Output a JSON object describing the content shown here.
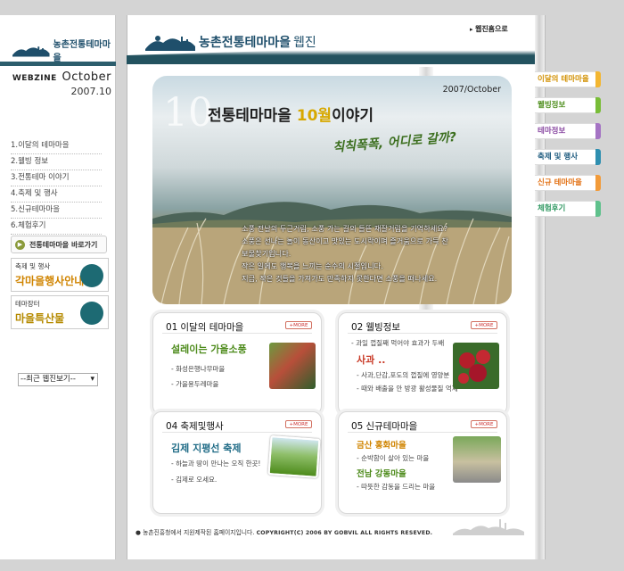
{
  "sidebar": {
    "logo_text": "농촌전통테마마을",
    "webzine_label": "WEBZINE",
    "issue_month": "October",
    "issue_date": "2007.10",
    "menu": [
      {
        "label": "1.이달의 테마마을"
      },
      {
        "label": "2.웰빙 정보"
      },
      {
        "label": "3.전통테마 이야기"
      },
      {
        "label": "4.축제 및 행사"
      },
      {
        "label": "5.신규테마마을"
      },
      {
        "label": "6.체험후기"
      }
    ],
    "shortcut_label": "전통테마마을 바로가기",
    "banner1": {
      "small": "축제 및 행사",
      "big": "각마을행사안내"
    },
    "banner2": {
      "small": "테마장터",
      "big": "마을특산물"
    },
    "past_select": "--최근 웹진보기--"
  },
  "header": {
    "home_link": "웹진홈으로",
    "logo_text": "농촌전통테마마을",
    "logo_suffix": "웹진"
  },
  "hero": {
    "number": "10",
    "title_pre": "전통테마마을 ",
    "title_month": "10월",
    "title_post": "이야기",
    "date": "2007/October",
    "slogan": "칙칙폭폭, 어디로 갈까?",
    "desc_lines": [
      "소풍 전날의 두근거림, 소풍 가는 길의 들뜬 재잘거림을 기억하세요?",
      "소풍은 선나는 놀이 동산이고 맛있는 도시락이며 즐거움으로 가득 찬",
      "보물찾기입니다.",
      "작은 일에도 행복을 느끼는 순수의 시절입니다.",
      "지금, 작은 것들을 가져가도 만족하지 못한다면 소풍을 떠나세요."
    ]
  },
  "cards": [
    {
      "num": "01",
      "title": "이달의 테마마을",
      "more": "+MORE",
      "head": "설레이는 가을소풍",
      "items": [
        "화성은행나무마을",
        "가을용두레마을"
      ]
    },
    {
      "num": "02",
      "title": "웰빙정보",
      "more": "+MORE",
      "sub": "과일 껍질째 먹어야 효과가 두배",
      "head": "사과 ..",
      "items": [
        "사과,단감,포도의 껍질에 영양분",
        "때와 배출을 안 방광 활성물질 억제"
      ]
    },
    {
      "num": "04",
      "title": "축제및행사",
      "more": "+MORE",
      "head": "김제 지평선 축제",
      "lines": [
        "하늘과 땅이 만나는 오직 한곳!",
        "김제로 오세요."
      ]
    },
    {
      "num": "05",
      "title": "신규테마마을",
      "more": "+MORE",
      "head": "금산 홍화마을",
      "items": [
        "순박함이 살아 있는 마을",
        "따뜻한 감동을 드리는 마을"
      ],
      "head2": "전남 강동마을"
    }
  ],
  "footer": {
    "text": "농촌진흥청에서 지원제작된 홈페이지입니다.",
    "copyright": "COPYRIGHT(C) 2006 BY GOBVIL ALL RIGHTS RESEVED."
  },
  "right_tabs": [
    {
      "label": "이달의 테마마을"
    },
    {
      "label": "웰빙정보"
    },
    {
      "label": "테마정보"
    },
    {
      "label": "축제 및 행사"
    },
    {
      "label": "신규 테마마을"
    },
    {
      "label": "체험후기"
    }
  ],
  "colors": {
    "teal": "#23525f",
    "accent_green": "#4d8b1b",
    "accent_yellow": "#d7a800"
  }
}
